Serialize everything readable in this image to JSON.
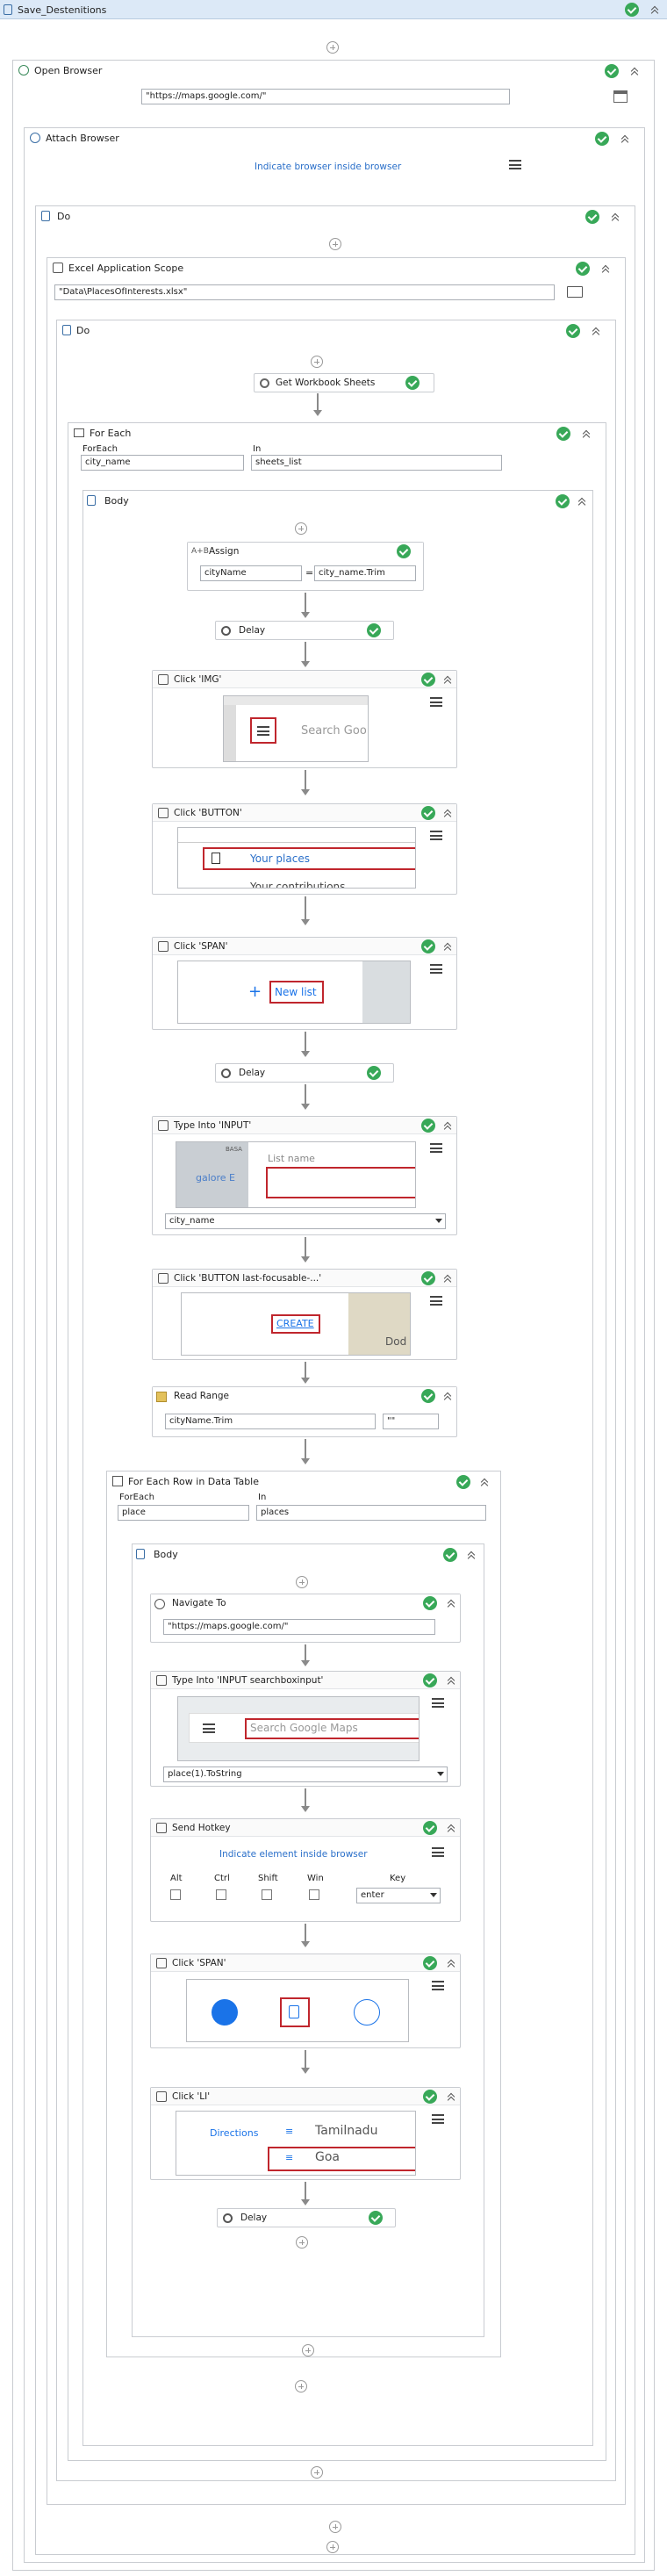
{
  "root": {
    "title": "Save_Destenitions"
  },
  "open_browser": {
    "title": "Open Browser",
    "url": "\"https://maps.google.com/\""
  },
  "attach_browser": {
    "title": "Attach Browser",
    "indicate": "Indicate browser inside browser"
  },
  "do1": {
    "title": "Do"
  },
  "excel": {
    "title": "Excel Application Scope",
    "path": "\"Data\\PlacesOfInterests.xlsx\""
  },
  "do2": {
    "title": "Do"
  },
  "get_sheets": {
    "title": "Get Workbook Sheets"
  },
  "for_each": {
    "title": "For Each",
    "foreach_label": "ForEach",
    "in_label": "In",
    "item": "city_name",
    "collection": "sheets_list"
  },
  "body1": {
    "title": "Body"
  },
  "assign": {
    "title": "Assign",
    "left": "cityName",
    "eq": "=",
    "right": "city_name.Trim"
  },
  "delay1": {
    "title": "Delay"
  },
  "click_img": {
    "title": "Click 'IMG'",
    "preview_text": "Search Goo"
  },
  "click_button": {
    "title": "Click 'BUTTON'",
    "preview_text": "Your places",
    "preview_text2": "Your contributions"
  },
  "click_span1": {
    "title": "Click 'SPAN'",
    "preview_text": "New list"
  },
  "delay2": {
    "title": "Delay"
  },
  "type_into1": {
    "title": "Type Into 'INPUT'",
    "preview_text": "List name",
    "preview_side": "galore E",
    "preview_top": "BASA",
    "value": "city_name"
  },
  "click_create": {
    "title": "Click 'BUTTON  last-focusable-...'",
    "preview_text": "CREATE",
    "preview_side": "Dod"
  },
  "read_range": {
    "title": "Read Range",
    "value": "cityName.Trim",
    "range": "\"\""
  },
  "for_each_row": {
    "title": "For Each Row in Data Table",
    "foreach_label": "ForEach",
    "in_label": "In",
    "item": "place",
    "collection": "places"
  },
  "body2": {
    "title": "Body"
  },
  "navigate": {
    "title": "Navigate To",
    "url": "\"https://maps.google.com/\""
  },
  "type_into2": {
    "title": "Type Into 'INPUT  searchboxinput'",
    "preview_text": "Search Google Maps",
    "value": "place(1).ToString"
  },
  "send_hotkey": {
    "title": "Send Hotkey",
    "indicate": "Indicate element inside browser",
    "alt": "Alt",
    "ctrl": "Ctrl",
    "shift": "Shift",
    "win": "Win",
    "key_label": "Key",
    "key": "enter"
  },
  "click_span2": {
    "title": "Click 'SPAN'"
  },
  "click_li": {
    "title": "Click 'LI'",
    "preview_directions": "Directions",
    "preview_item1": "Tamilnadu",
    "preview_item2": "Goa"
  },
  "delay3": {
    "title": "Delay"
  },
  "colors": {
    "success": "#38a858",
    "header_bar": "#dce9f7",
    "link": "#2a6fc9",
    "highlight": "#c0262d"
  }
}
